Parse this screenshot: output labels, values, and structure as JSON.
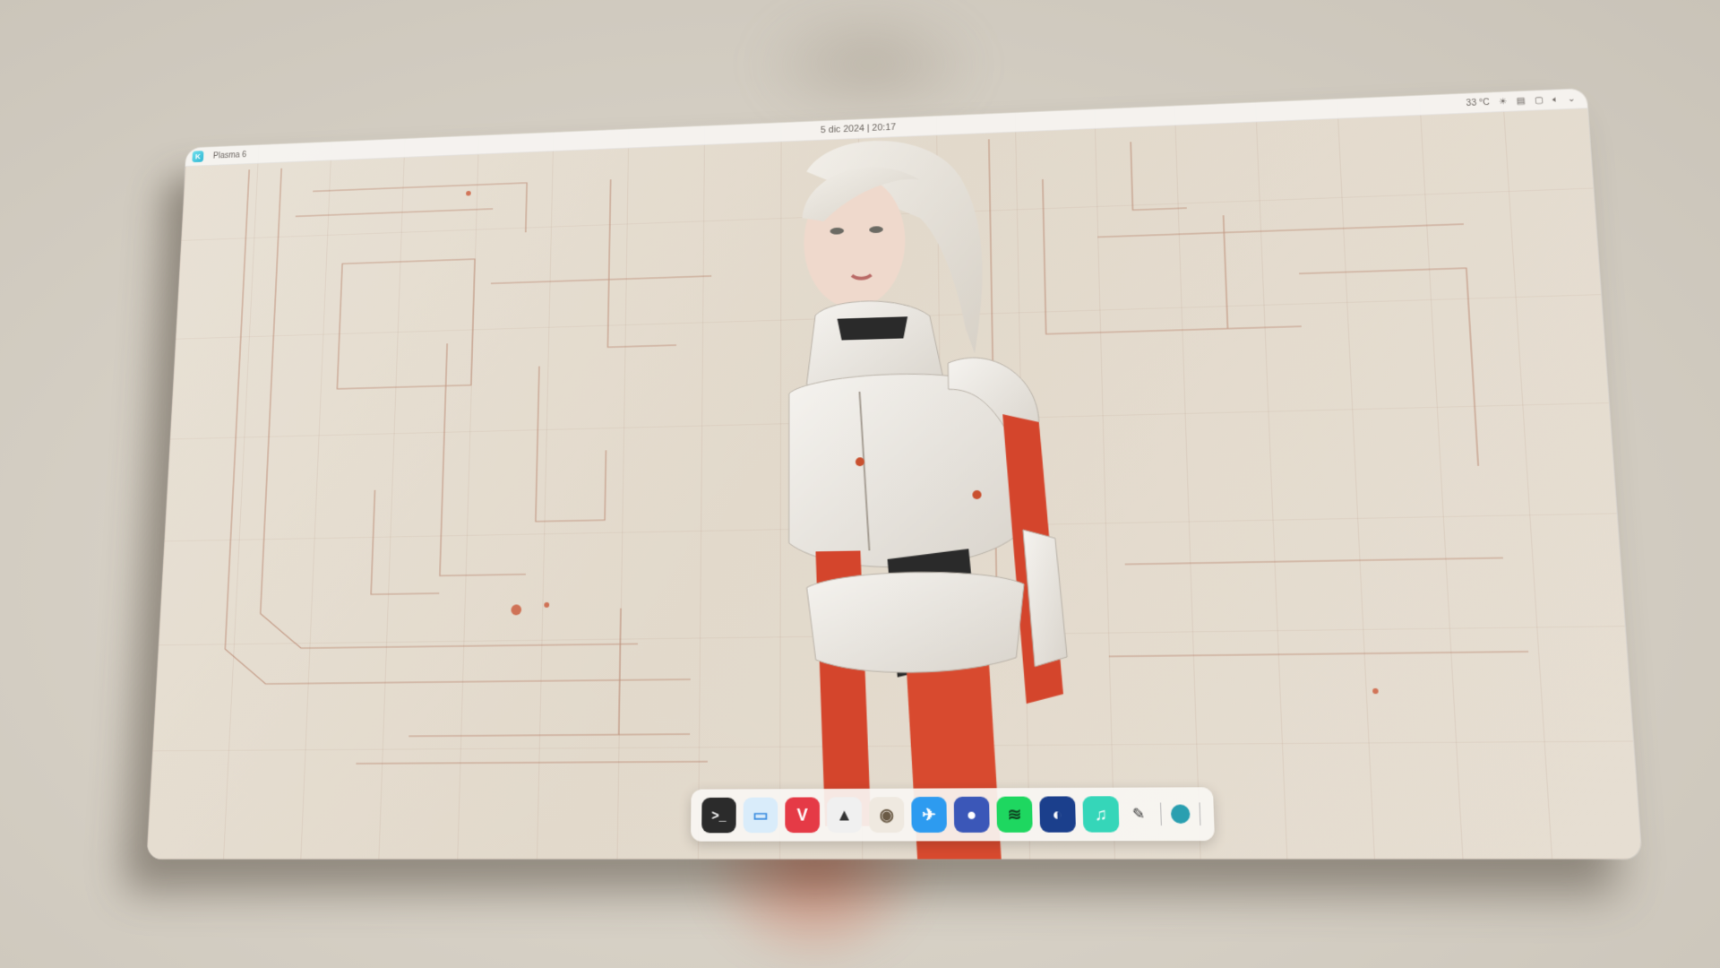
{
  "panel": {
    "launcher_glyph": "K",
    "activity_label": "Plasma 6",
    "clock": "5 dic 2024 | 20:17",
    "temperature": "33 °C"
  },
  "tray_icons": [
    "brightness-icon",
    "clipboard-icon",
    "display-icon",
    "volume-icon",
    "chevron-down-icon"
  ],
  "dock": {
    "items": [
      {
        "name": "terminal-icon",
        "glyph": ">_",
        "color": "#2b2b2b"
      },
      {
        "name": "files-icon",
        "glyph": "▭",
        "color": "#6db2ee"
      },
      {
        "name": "vivaldi-icon",
        "glyph": "V",
        "color": "#e53a46"
      },
      {
        "name": "inkscape-icon",
        "glyph": "▲",
        "color": "#f0f0f0"
      },
      {
        "name": "gimp-icon",
        "glyph": "◉",
        "color": "#efe9e0"
      },
      {
        "name": "kdeconnect-icon",
        "glyph": "✈",
        "color": "#2d9bf0"
      },
      {
        "name": "podcast-icon",
        "glyph": "●",
        "color": "#3b57b8"
      },
      {
        "name": "spotify-icon",
        "glyph": "≋",
        "color": "#1ed760"
      },
      {
        "name": "steam-icon",
        "glyph": "◐",
        "color": "#1b3f8c"
      },
      {
        "name": "music-icon",
        "glyph": "♫",
        "color": "#35d6b9"
      }
    ],
    "extras": [
      {
        "name": "pen-icon",
        "glyph": "✎"
      },
      {
        "name": "color-picker-icon",
        "glyph": "●"
      }
    ]
  },
  "colors": {
    "accent": "#2fb6d2",
    "suit_red": "#d4452c",
    "paper": "#e4dccf"
  }
}
